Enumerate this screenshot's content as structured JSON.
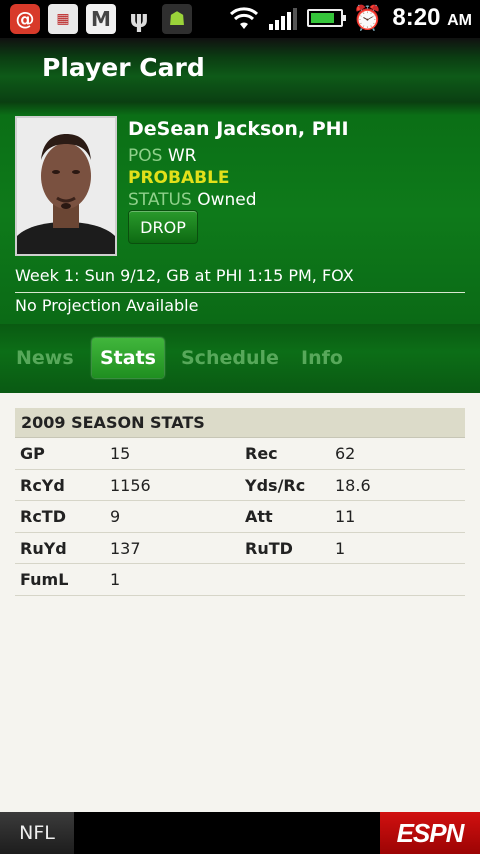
{
  "status_bar": {
    "time": "8:20",
    "ampm": "AM",
    "icons": [
      "email-icon",
      "calendar-icon",
      "gmail-icon",
      "usb-icon",
      "android-debug-icon",
      "wifi-icon",
      "signal-icon",
      "battery-icon",
      "alarm-icon"
    ],
    "battery_level": 0.85,
    "signal_level": 0.75
  },
  "header": {
    "title": "Player Card"
  },
  "player": {
    "name": "DeSean Jackson, PHI",
    "pos_label": "POS",
    "pos_value": "WR",
    "injury_status": "PROBABLE",
    "status_label": "STATUS",
    "status_value": "Owned",
    "drop_label": "DROP",
    "game_info": "Week 1: Sun 9/12, GB at PHI 1:15 PM, FOX",
    "projection": "No Projection Available"
  },
  "tabs": [
    {
      "label": "News",
      "active": false
    },
    {
      "label": "Stats",
      "active": true
    },
    {
      "label": "Schedule",
      "active": false
    },
    {
      "label": "Info",
      "active": false
    }
  ],
  "stats": {
    "title": "2009 SEASON STATS",
    "rows": [
      [
        "GP",
        "15",
        "Rec",
        "62"
      ],
      [
        "RcYd",
        "1156",
        "Yds/Rc",
        "18.6"
      ],
      [
        "RcTD",
        "9",
        "Att",
        "11"
      ],
      [
        "RuYd",
        "137",
        "RuTD",
        "1"
      ],
      [
        "FumL",
        "1",
        "",
        ""
      ]
    ]
  },
  "footer": {
    "league": "NFL",
    "brand": "ESPN"
  },
  "colors": {
    "accent_green": "#0e7a1a",
    "probable_yellow": "#e2e01a",
    "espn_red": "#d11010"
  }
}
